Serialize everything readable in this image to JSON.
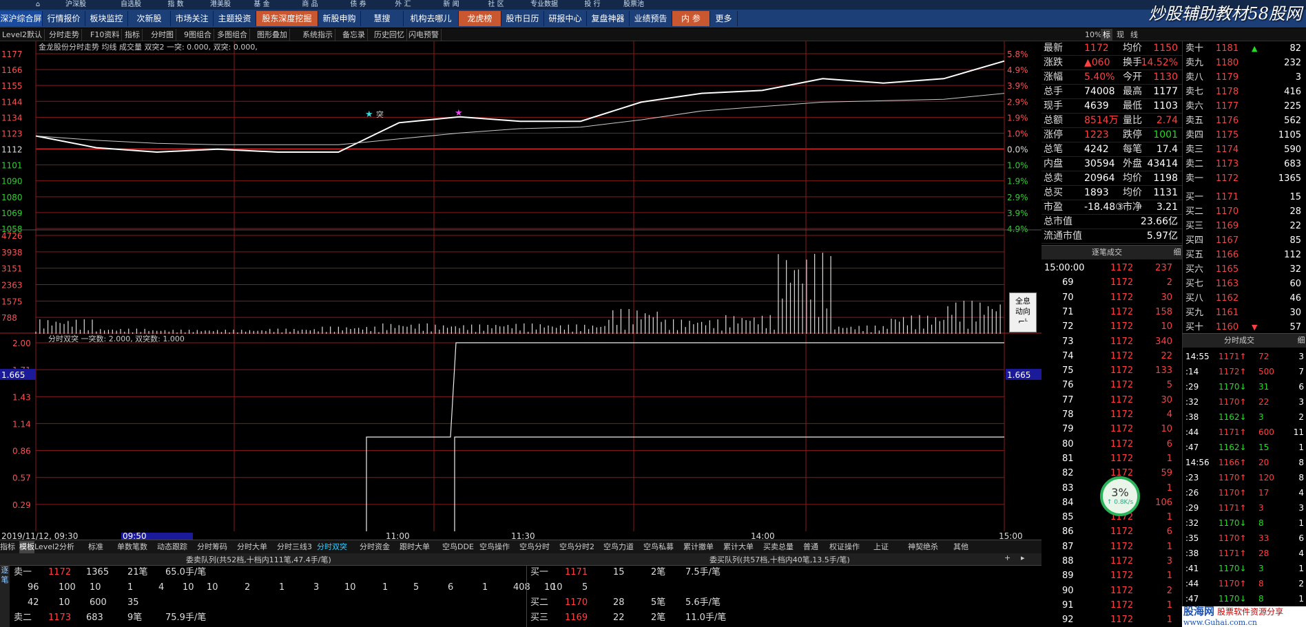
{
  "topbar": [
    "沪深股",
    "自选股",
    "指 数",
    "港美股",
    "基 金",
    "商 品",
    "债 券",
    "外 汇",
    "新 闻",
    "社 区",
    "专业数据",
    "投 行",
    "股票池"
  ],
  "nav": {
    "items": [
      "深沪综合屏",
      "行情报价",
      "板块监控",
      "次新股",
      "市场关注",
      "主题投资",
      "股东深度挖掘",
      "新股申购",
      "慧搜",
      "机构去哪儿",
      "龙虎榜",
      "股市日历",
      "研报中心",
      "复盘神器",
      "业绩预告",
      "内 参",
      "更多"
    ],
    "watermark": "炒股辅助教材58股网"
  },
  "toolbar": [
    "Level2默认",
    "分时走势",
    "F10资料",
    "指标",
    "分时图",
    "9图组合",
    "多图组合",
    "图形叠加",
    "系统指示",
    "备忘录",
    "历史回忆",
    "闪电预警"
  ],
  "right_tabs": [
    "10%",
    "标",
    "现",
    "线"
  ],
  "chart": {
    "title": "金龙股份分时走势 均线 成交量 双突2 一突: 0.000, 双突: 0.000,",
    "price_ticks": [
      "1177",
      "1166",
      "1155",
      "1144",
      "1134",
      "1123",
      "1112",
      "1101",
      "1090",
      "1080",
      "1069",
      "1058"
    ],
    "pct_ticks": [
      "5.8%",
      "4.9%",
      "3.9%",
      "2.9%",
      "1.9%",
      "1.0%",
      "0.0%",
      "1.0%",
      "1.9%",
      "2.9%",
      "3.9%",
      "4.9%"
    ],
    "vol_ticks": [
      "4726",
      "3938",
      "3151",
      "2363",
      "1575",
      "788"
    ],
    "ind_title": "分时双突  一突数: 2.000, 双突数: 1.000",
    "ind_ticks": [
      "2.00",
      "1.71",
      "1.43",
      "1.14",
      "0.86",
      "0.57",
      "0.29"
    ],
    "ind_cursor_value": "1.665",
    "marker_label": "突",
    "time_ticks": [
      "2019/11/12, 09:30",
      "09:50",
      "11:00",
      "11:30",
      "14:00",
      "15:00"
    ]
  },
  "chart_data": {
    "type": "line",
    "title": "金龙股份分时走势",
    "xlabel": "",
    "ylabel": "",
    "x": [
      "09:30",
      "09:45",
      "10:00",
      "10:15",
      "10:30",
      "10:45",
      "11:00",
      "11:15",
      "11:30",
      "13:15",
      "13:30",
      "13:45",
      "14:00",
      "14:15",
      "14:30",
      "14:45",
      "15:00"
    ],
    "ylim": [
      1058,
      1177
    ],
    "series": [
      {
        "name": "价格",
        "values": [
          1121,
          1113,
          1110,
          1112,
          1110,
          1110,
          1130,
          1134,
          1131,
          1131,
          1144,
          1150,
          1152,
          1160,
          1157,
          1160,
          1172
        ]
      },
      {
        "name": "均线",
        "values": [
          1121,
          1118,
          1116,
          1115,
          1115,
          1115,
          1119,
          1123,
          1126,
          1127,
          1132,
          1138,
          1141,
          1144,
          1145,
          1146,
          1150
        ]
      }
    ],
    "volume": {
      "ylim": [
        0,
        4726
      ],
      "values": [
        700,
        250,
        200,
        200,
        250,
        350,
        500,
        450,
        500,
        450,
        1200,
        700,
        900,
        3900,
        400,
        900,
        1600
      ]
    }
  },
  "bottom_tabs": [
    "指标",
    "模板",
    "Level2分析",
    "标准",
    "单数笔数",
    "动态跟踪",
    "分时筹码",
    "分时大单",
    "分时三线3",
    "分时双突",
    "分时资金",
    "跟时大单",
    "空鸟DDE",
    "空鸟操作",
    "空鸟分时",
    "空鸟分时2",
    "空鸟力道",
    "空鸟私募",
    "累计撤单",
    "累计大单",
    "买卖总量",
    "普通",
    "权证操作",
    "上证",
    "神契绝杀",
    "其他"
  ],
  "queue": {
    "sell_hdr": "委卖队列(共52档,十档内111笔,47.4手/笔)",
    "buy_hdr": "委买队列(共57档,十档内40笔,13.5手/笔)",
    "side_label": "逐笔",
    "rows_left": [
      [
        "卖一",
        "1172",
        "1365",
        "21笔",
        "65.0手/笔"
      ],
      [
        "96",
        "100",
        "10",
        "1",
        "4",
        "10",
        "10",
        "2",
        "1",
        "3",
        "10",
        "1",
        "5",
        "6",
        "1",
        "408",
        "10"
      ],
      [
        "42",
        "10",
        "600",
        "35"
      ],
      [
        "卖二",
        "1173",
        "683",
        "9笔",
        "75.9手/笔"
      ]
    ],
    "rows_right": [
      [
        "买一",
        "1171",
        "15",
        "2笔",
        "7.5手/笔"
      ],
      [
        "10",
        "5"
      ],
      [
        "买二",
        "1170",
        "28",
        "5笔",
        "5.6手/笔"
      ],
      [
        "买三",
        "1169",
        "22",
        "2笔",
        "11.0手/笔"
      ]
    ]
  },
  "quote": [
    [
      "最新",
      "1172",
      "均价",
      "1150"
    ],
    [
      "涨跌",
      "▲060",
      "换手",
      "14.52%"
    ],
    [
      "涨幅",
      "5.40%",
      "今开",
      "1130"
    ],
    [
      "总手",
      "74008",
      "最高",
      "1177"
    ],
    [
      "现手",
      "4639",
      "最低",
      "1103"
    ],
    [
      "总额",
      "8514万",
      "量比",
      "2.74"
    ],
    [
      "涨停",
      "1223",
      "跌停",
      "1001"
    ],
    [
      "总笔",
      "4242",
      "每笔",
      "17.4"
    ],
    [
      "内盘",
      "30594",
      "外盘",
      "43414"
    ],
    [
      "总卖",
      "20964",
      "均价",
      "1198"
    ],
    [
      "总买",
      "1893",
      "均价",
      "1131"
    ],
    [
      "市盈",
      "-18.48③",
      "市净",
      "3.21"
    ],
    [
      "总市值",
      "",
      "",
      "23.66亿"
    ],
    [
      "流通市值",
      "",
      "",
      "5.97亿"
    ]
  ],
  "book": [
    [
      "卖十",
      "1181",
      "▲",
      "82"
    ],
    [
      "卖九",
      "1180",
      "",
      "232"
    ],
    [
      "卖八",
      "1179",
      "",
      "3"
    ],
    [
      "卖七",
      "1178",
      "",
      "416"
    ],
    [
      "卖六",
      "1177",
      "",
      "225"
    ],
    [
      "卖五",
      "1176",
      "",
      "562"
    ],
    [
      "卖四",
      "1175",
      "",
      "1105"
    ],
    [
      "卖三",
      "1174",
      "",
      "590"
    ],
    [
      "卖二",
      "1173",
      "",
      "683"
    ],
    [
      "卖一",
      "1172",
      "",
      "1365"
    ],
    [
      "买一",
      "1171",
      "",
      "15"
    ],
    [
      "买二",
      "1170",
      "",
      "28"
    ],
    [
      "买三",
      "1169",
      "",
      "22"
    ],
    [
      "买四",
      "1167",
      "",
      "85"
    ],
    [
      "买五",
      "1166",
      "",
      "112"
    ],
    [
      "买六",
      "1165",
      "",
      "32"
    ],
    [
      "买七",
      "1163",
      "",
      "60"
    ],
    [
      "买八",
      "1162",
      "",
      "46"
    ],
    [
      "买九",
      "1161",
      "",
      "30"
    ],
    [
      "买十",
      "1160",
      "▼",
      "57"
    ]
  ],
  "trades": {
    "title": "逐笔成交",
    "side": "细",
    "rows": [
      [
        "15:00:00",
        "1172",
        "237"
      ],
      [
        "69",
        "1172",
        "2"
      ],
      [
        "70",
        "1172",
        "30"
      ],
      [
        "71",
        "1172",
        "158"
      ],
      [
        "72",
        "1172",
        "10"
      ],
      [
        "73",
        "1172",
        "340"
      ],
      [
        "74",
        "1172",
        "22"
      ],
      [
        "75",
        "1172",
        "133"
      ],
      [
        "76",
        "1172",
        "5"
      ],
      [
        "77",
        "1172",
        "30"
      ],
      [
        "78",
        "1172",
        "4"
      ],
      [
        "79",
        "1172",
        "10"
      ],
      [
        "80",
        "1172",
        "6"
      ],
      [
        "81",
        "1172",
        "1"
      ],
      [
        "82",
        "1172",
        "59"
      ],
      [
        "83",
        "1172",
        "1"
      ],
      [
        "84",
        "1172",
        "106"
      ],
      [
        "85",
        "1172",
        "1"
      ],
      [
        "86",
        "1172",
        "6"
      ],
      [
        "87",
        "1172",
        "1"
      ],
      [
        "88",
        "1172",
        "3"
      ],
      [
        "89",
        "1172",
        "1"
      ],
      [
        "90",
        "1172",
        "2"
      ],
      [
        "91",
        "1172",
        "1"
      ],
      [
        "92",
        "1172",
        "1"
      ]
    ]
  },
  "ticks": {
    "title": "分时成交",
    "side": "细",
    "rows": [
      [
        "14:55",
        "1171↑",
        "72",
        "3"
      ],
      [
        ":14",
        "1172↑",
        "500",
        "7"
      ],
      [
        ":29",
        "1170↓",
        "31",
        "6"
      ],
      [
        ":32",
        "1170↑",
        "22",
        "3"
      ],
      [
        ":38",
        "1162↓",
        "3",
        "2"
      ],
      [
        ":44",
        "1171↑",
        "600",
        "11"
      ],
      [
        ":47",
        "1162↓",
        "15",
        "1"
      ],
      [
        "14:56",
        "1166↑",
        "20",
        "8"
      ],
      [
        ":23",
        "1170↑",
        "120",
        "8"
      ],
      [
        ":26",
        "1170↑",
        "17",
        "4"
      ],
      [
        ":29",
        "1171↑",
        "3",
        "3"
      ],
      [
        ":32",
        "1170↓",
        "8",
        "1"
      ],
      [
        ":35",
        "1170↑",
        "33",
        "6"
      ],
      [
        ":38",
        "1171↑",
        "28",
        "4"
      ],
      [
        ":41",
        "1170↓",
        "3",
        "1"
      ],
      [
        ":44",
        "1170↑",
        "8",
        "2"
      ],
      [
        ":47",
        "1170↓",
        "8",
        "1"
      ],
      [
        ":50",
        "1170↑",
        "8",
        "1"
      ],
      [
        ":53",
        "1171↑",
        "8",
        "2"
      ]
    ]
  },
  "float_btn": [
    "全息",
    "动向"
  ],
  "speed": {
    "pct": "3%",
    "rate": "↑ 0.8K/s"
  },
  "bottom_watermark": {
    "brand": "股海网",
    "tagline": "股票软件资源分享",
    "url": "www.Guhai.com.cn"
  },
  "colors": {
    "up": "#ff3333",
    "down": "#22dd22",
    "price_line": "#ffffff",
    "avg_line": "#cccccc",
    "grid": "#8b1a1a",
    "accent": "#1d3f78"
  }
}
